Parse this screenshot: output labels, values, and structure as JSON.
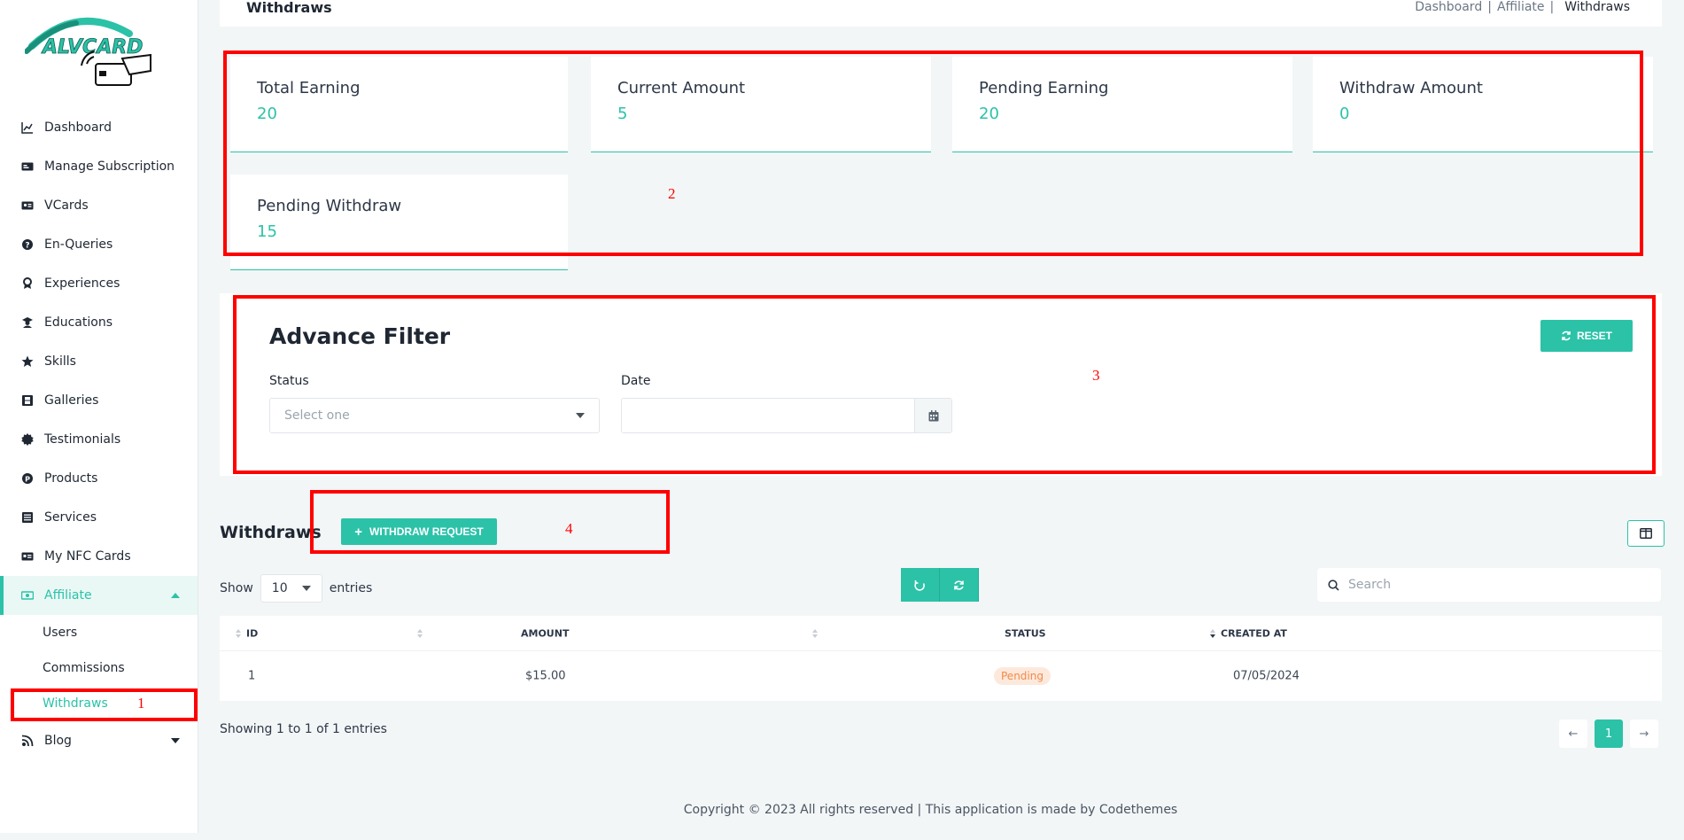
{
  "brand": {
    "logo_text": "ALVCARD"
  },
  "sidebar": {
    "items": [
      {
        "label": "Dashboard",
        "icon": "chart-line-icon"
      },
      {
        "label": "Manage Subscription",
        "icon": "id-card-icon"
      },
      {
        "label": "VCards",
        "icon": "vcard-icon"
      },
      {
        "label": "En-Queries",
        "icon": "question-circle-icon"
      },
      {
        "label": "Experiences",
        "icon": "award-icon"
      },
      {
        "label": "Educations",
        "icon": "graduate-icon"
      },
      {
        "label": "Skills",
        "icon": "star-icon"
      },
      {
        "label": "Galleries",
        "icon": "film-icon"
      },
      {
        "label": "Testimonials",
        "icon": "certificate-icon"
      },
      {
        "label": "Products",
        "icon": "product-icon"
      },
      {
        "label": "Services",
        "icon": "list-icon"
      },
      {
        "label": "My NFC Cards",
        "icon": "nfc-card-icon"
      },
      {
        "label": "Affiliate",
        "icon": "money-icon"
      }
    ],
    "affiliate_sub": [
      "Users",
      "Commissions",
      "Withdraws"
    ],
    "blog": {
      "label": "Blog",
      "icon": "blog-icon"
    }
  },
  "header": {
    "title": "Withdraws",
    "breadcrumb": [
      "Dashboard",
      "Affiliate",
      "Withdraws"
    ],
    "separator": "|"
  },
  "stats": [
    {
      "label": "Total Earning",
      "value": "20"
    },
    {
      "label": "Current Amount",
      "value": "5"
    },
    {
      "label": "Pending Earning",
      "value": "20"
    },
    {
      "label": "Withdraw Amount",
      "value": "0"
    },
    {
      "label": "Pending Withdraw",
      "value": "15"
    }
  ],
  "filter": {
    "title": "Advance Filter",
    "reset_label": "RESET",
    "status_label": "Status",
    "status_placeholder": "Select one",
    "date_label": "Date",
    "date_value": ""
  },
  "withdraws": {
    "title": "Withdraws",
    "request_label": "WITHDRAW REQUEST",
    "show_label": "Show",
    "entries_value": "10",
    "entries_label": "entries",
    "search_placeholder": "Search",
    "columns": [
      "ID",
      "AMOUNT",
      "STATUS",
      "CREATED AT"
    ],
    "rows": [
      {
        "id": "1",
        "amount": "$15.00",
        "status": "Pending",
        "created_at": "07/05/2024"
      }
    ],
    "info": "Showing 1 to 1 of 1 entries",
    "page": "1"
  },
  "annotations": [
    "1",
    "2",
    "3",
    "4"
  ],
  "footer": "Copyright © 2023 All rights reserved | This application is made by Codethemes",
  "colors": {
    "accent": "#2bc2a8",
    "highlight": "#ff0000",
    "pending_badge": "#f08a4b"
  }
}
